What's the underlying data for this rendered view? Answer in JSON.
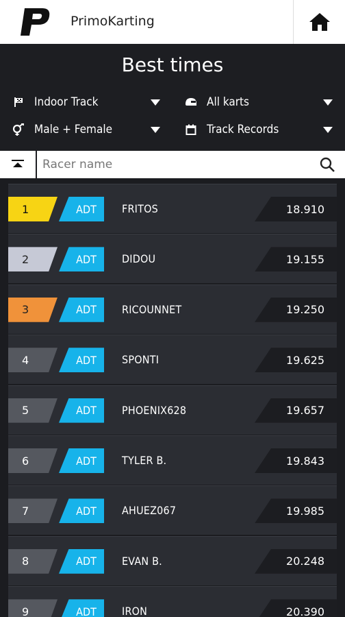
{
  "app": {
    "title": "PrimoKarting"
  },
  "header": {
    "title": "Best times"
  },
  "filters": {
    "track": "Indoor Track",
    "karts": "All karts",
    "gender": "Male + Female",
    "records": "Track Records"
  },
  "search": {
    "placeholder": "Racer name",
    "value": ""
  },
  "colors": {
    "gold": "#f7d414",
    "silver": "#c6c9d6",
    "bronze": "#f0923a",
    "default_rank": "#55585f",
    "badge": "#17b3ea"
  },
  "results": [
    {
      "rank": "1",
      "tag": "ADT",
      "name": "FRITOS",
      "time": "18.910"
    },
    {
      "rank": "2",
      "tag": "ADT",
      "name": "DIDOU",
      "time": "19.155"
    },
    {
      "rank": "3",
      "tag": "ADT",
      "name": "RICOUNNET",
      "time": "19.250"
    },
    {
      "rank": "4",
      "tag": "ADT",
      "name": "SPONTI",
      "time": "19.625"
    },
    {
      "rank": "5",
      "tag": "ADT",
      "name": "PHOENIX628",
      "time": "19.657"
    },
    {
      "rank": "6",
      "tag": "ADT",
      "name": "TYLER B.",
      "time": "19.843"
    },
    {
      "rank": "7",
      "tag": "ADT",
      "name": "AHUEZ067",
      "time": "19.985"
    },
    {
      "rank": "8",
      "tag": "ADT",
      "name": "EVAN B.",
      "time": "20.248"
    },
    {
      "rank": "9",
      "tag": "ADT",
      "name": "IRON",
      "time": "20.390"
    }
  ]
}
